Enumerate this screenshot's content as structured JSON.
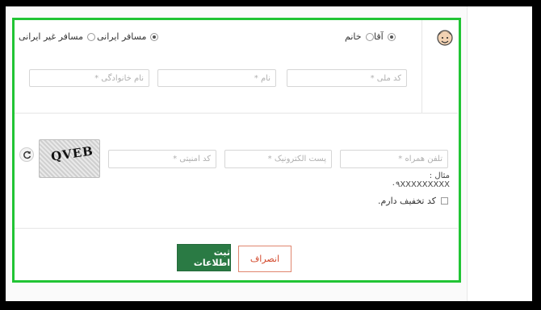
{
  "passenger_type": {
    "iranian_label": "مسافر ایرانی",
    "non_iranian_label": "مسافر غیر ایرانی"
  },
  "gender": {
    "male_label": "آقا",
    "female_label": "خانم"
  },
  "personal": {
    "national_code_placeholder": "کد ملی *",
    "first_name_placeholder": "نام *",
    "last_name_placeholder": "نام خانوادگی *"
  },
  "contact": {
    "mobile_placeholder": "تلفن همراه *",
    "email_placeholder": "پست الکترونیک *",
    "security_code_placeholder": "کد امنیتی *",
    "mobile_example": "مثال : ۰۹XXXXXXXXX",
    "captcha_text": "QVEB",
    "discount_label": "کد تخفیف دارم."
  },
  "actions": {
    "submit_label": "ثبت اطلاعات",
    "cancel_label": "انصراف"
  },
  "colors": {
    "frame_green": "#21c434",
    "submit_green": "#2a7a44",
    "cancel_red": "#d34a2d"
  }
}
